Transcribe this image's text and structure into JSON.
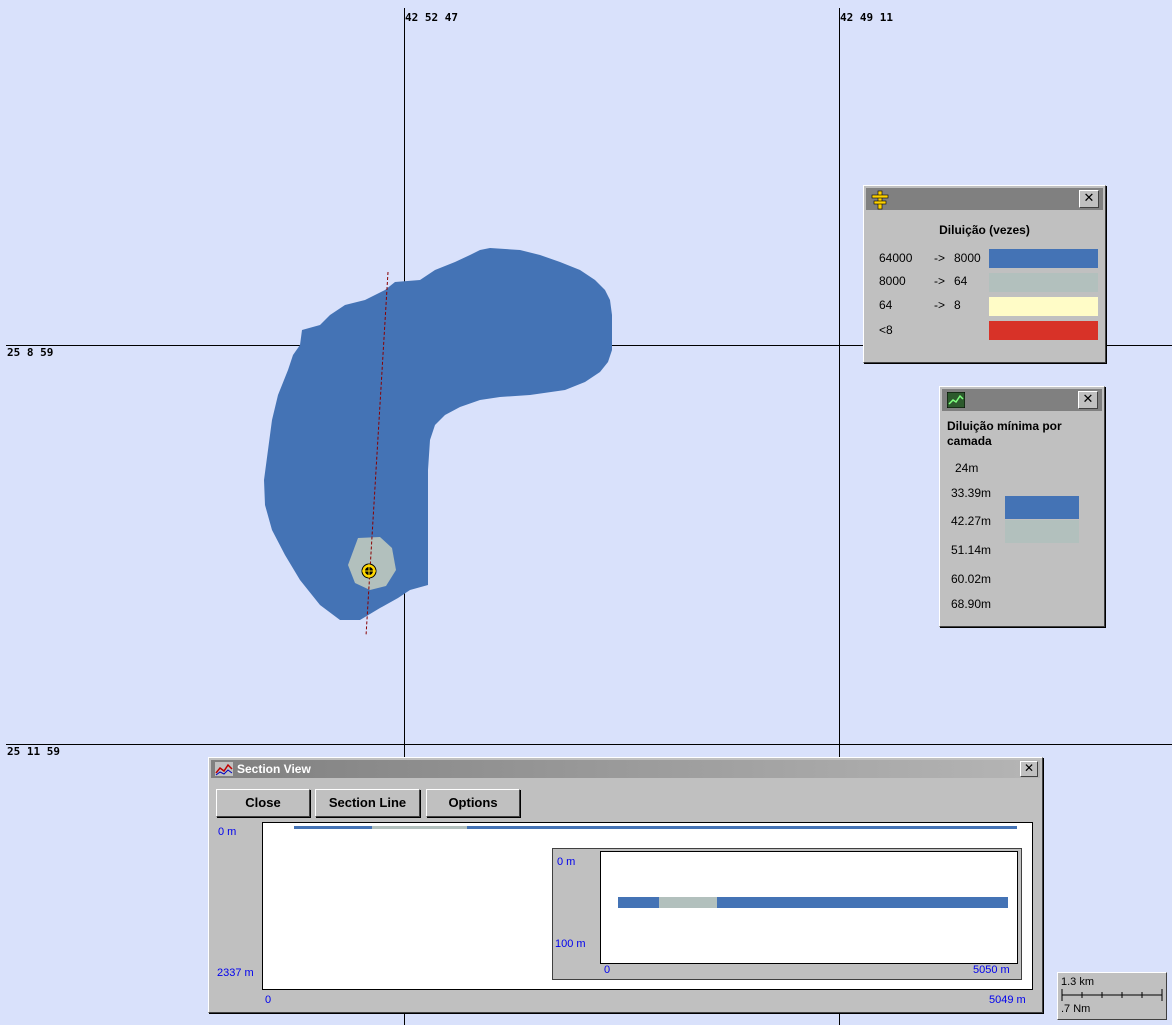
{
  "map": {
    "lon_labels": [
      "42 52 47",
      "42 49 11"
    ],
    "lat_labels": [
      "25 8 59",
      "25 11 59"
    ],
    "background": "#d9e1fb",
    "plume_colors": {
      "dilution_high": "#4473b5",
      "dilution_mid": "#b2c0bd",
      "source_marker": "#ffd700",
      "section_line": "#8b0000"
    }
  },
  "legend_dilution": {
    "icon": "surface-plume-icon",
    "close_label": "✕",
    "title": "Diluição (vezes)",
    "rows": [
      {
        "from": "64000",
        "arrow": "->",
        "to": "8000",
        "color": "#4473b5"
      },
      {
        "from": "8000",
        "arrow": "->",
        "to": "64",
        "color": "#b2c0bd"
      },
      {
        "from": "64",
        "arrow": "->",
        "to": "8",
        "color": "#fffcc7"
      },
      {
        "from": "<8",
        "arrow": "",
        "to": "",
        "color": "#d83228"
      }
    ]
  },
  "legend_depth": {
    "icon": "layer-chart-icon",
    "close_label": "✕",
    "title": "Diluição mínima por camada",
    "depths": [
      "24m",
      "33.39m",
      "42.27m",
      "51.14m",
      "60.02m",
      "68.90m"
    ],
    "bars": [
      {
        "color": "#4473b5"
      },
      {
        "color": "#b2c0bd"
      }
    ]
  },
  "section_view": {
    "icon": "section-chart-icon",
    "title": "Section View",
    "close_label": "✕",
    "buttons": [
      "Close",
      "Section Line",
      "Options"
    ],
    "main_plot": {
      "y_top": "0 m",
      "y_bottom": "2337 m",
      "x_left": "0",
      "x_right": "5049 m"
    },
    "inset_plot": {
      "y_top": "0 m",
      "y_bottom": "100 m",
      "x_left": "0",
      "x_right": "5050 m"
    }
  },
  "scale_bar": {
    "km": "1.3 km",
    "nm": ".7 Nm"
  }
}
